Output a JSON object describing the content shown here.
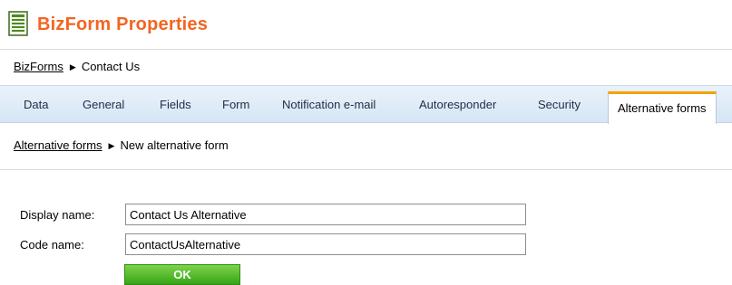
{
  "header": {
    "title": "BizForm Properties",
    "icon": "form-document-icon"
  },
  "breadcrumb_top": {
    "link": "BizForms",
    "current": "Contact Us"
  },
  "tabs": [
    {
      "label": "Data"
    },
    {
      "label": "General"
    },
    {
      "label": "Fields"
    },
    {
      "label": "Form"
    },
    {
      "label": "Notification e-mail"
    },
    {
      "label": "Autoresponder"
    },
    {
      "label": "Security"
    },
    {
      "label": "Alternative forms",
      "active": true
    }
  ],
  "breadcrumb_sub": {
    "link": "Alternative forms",
    "current": "New alternative form"
  },
  "form": {
    "display_name_label": "Display name:",
    "display_name_value": "Contact Us Alternative",
    "code_name_label": "Code name:",
    "code_name_value": "ContactUsAlternative",
    "ok_label": "OK"
  },
  "colors": {
    "title": "#f26522",
    "active_tab_accent": "#f5a100",
    "ok_button": "#4bb826"
  }
}
